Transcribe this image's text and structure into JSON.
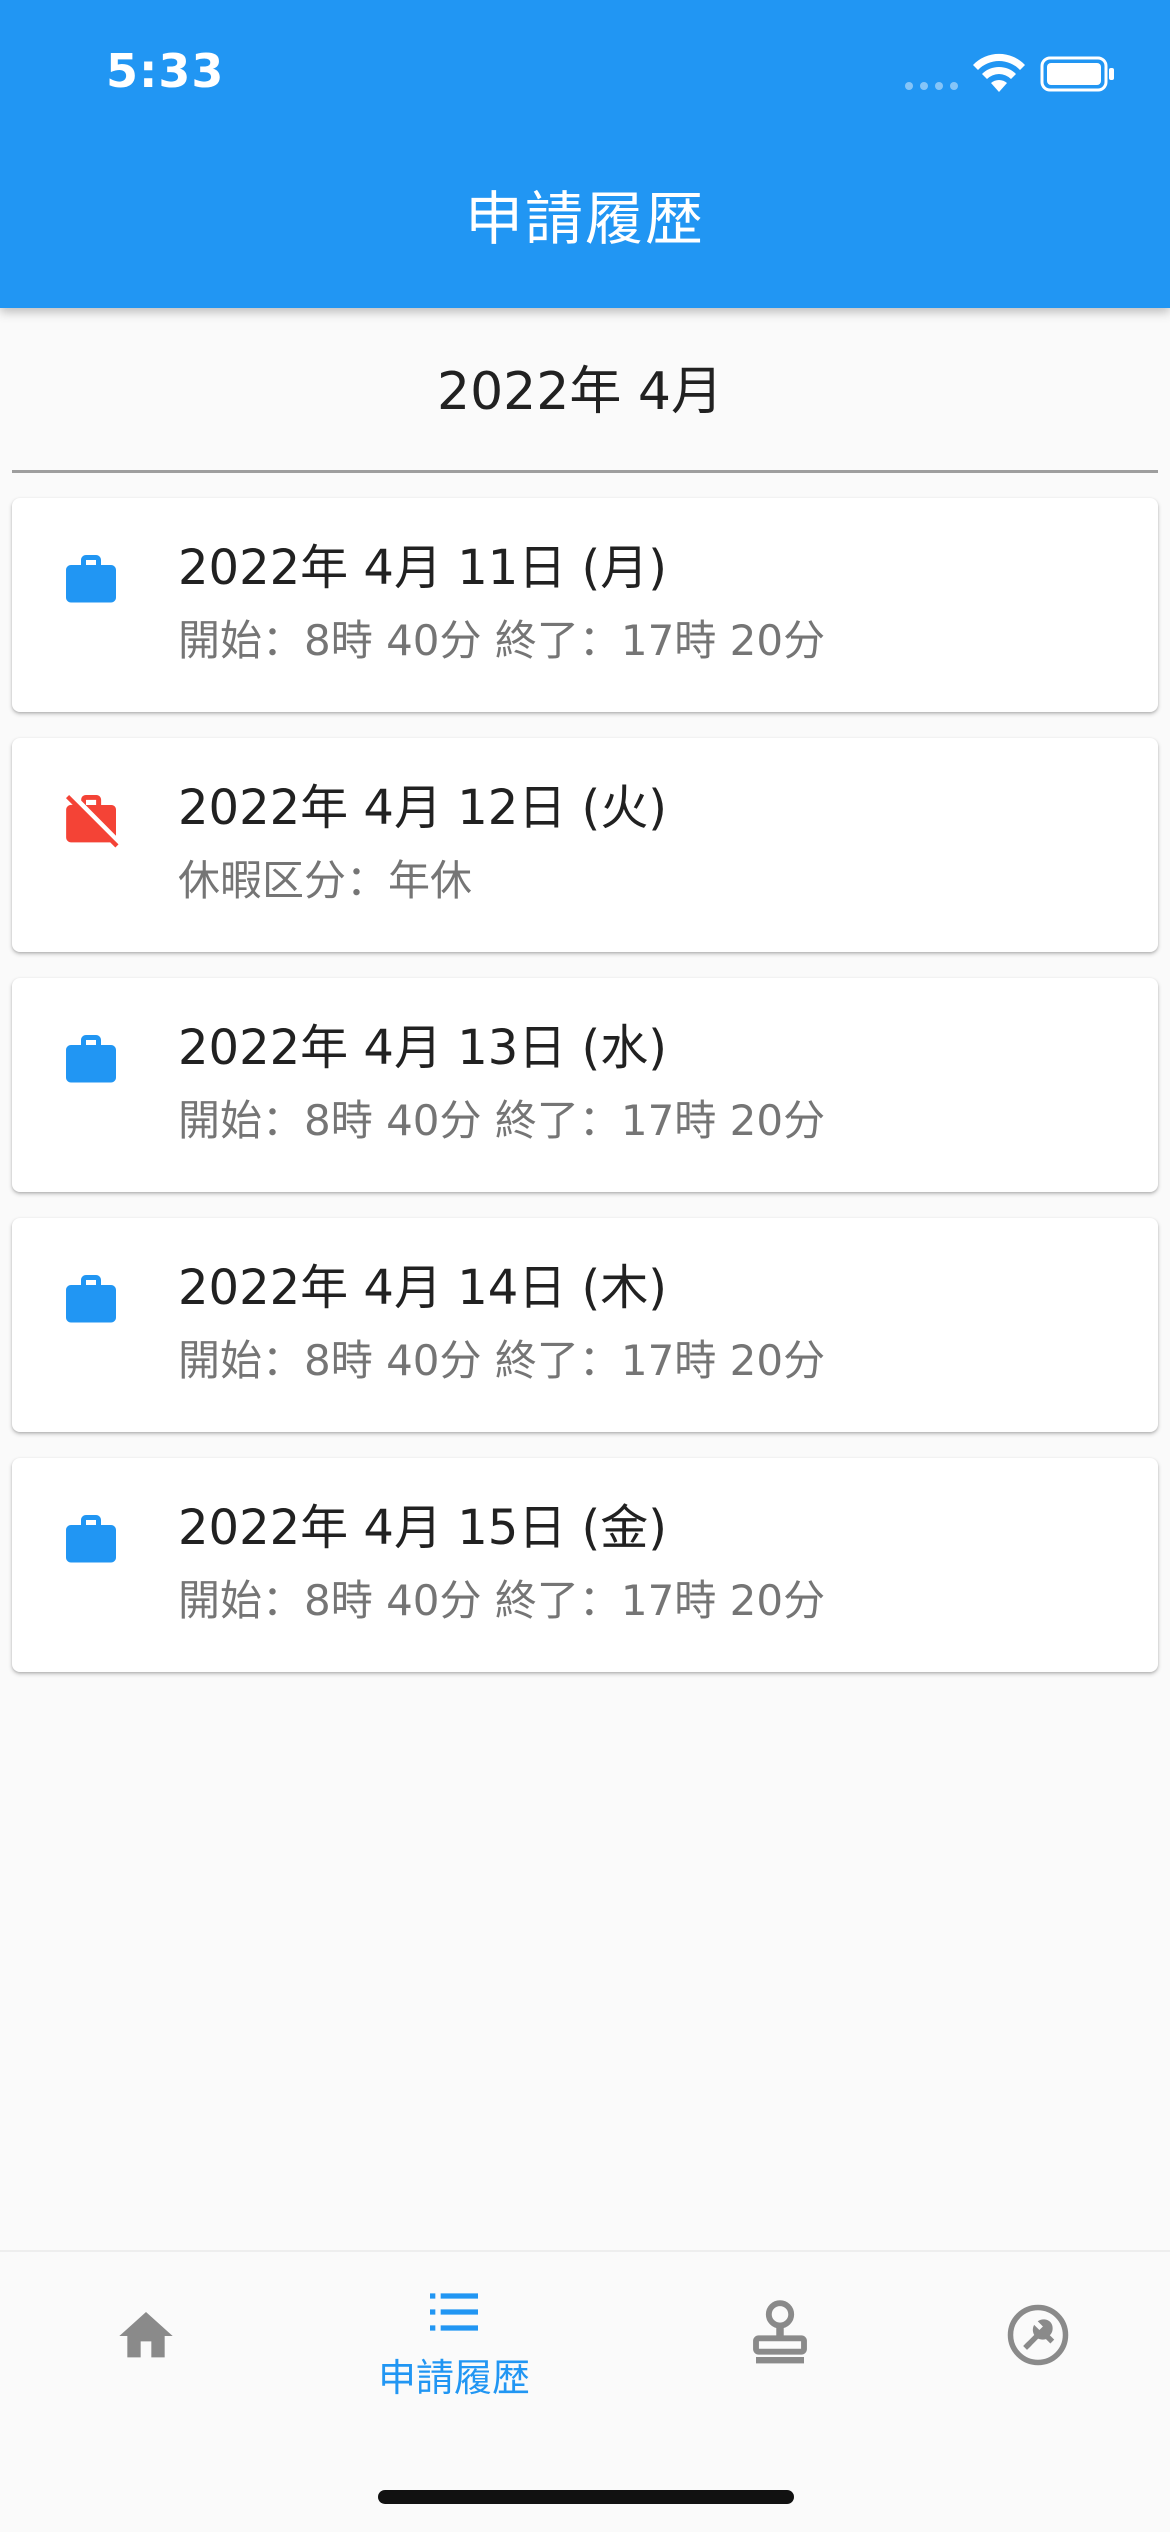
{
  "status_bar": {
    "time": "5:33"
  },
  "app_bar": {
    "title": "申請履歴"
  },
  "month_header": "2022年 4月",
  "colors": {
    "primary": "#2196f3",
    "work_icon": "#2196f3",
    "off_icon": "#f44336",
    "inactive_nav": "#8a8a8a"
  },
  "entries": [
    {
      "icon": "work-briefcase-icon",
      "date": "2022年 4月 11日 (月)",
      "detail": "開始：8時 40分   終了：17時 20分"
    },
    {
      "icon": "work-off-icon",
      "date": "2022年 4月 12日 (火)",
      "detail": "休暇区分：年休"
    },
    {
      "icon": "work-briefcase-icon",
      "date": "2022年 4月 13日 (水)",
      "detail": "開始：8時 40分   終了：17時 20分"
    },
    {
      "icon": "work-briefcase-icon",
      "date": "2022年 4月 14日 (木)",
      "detail": "開始：8時 40分   終了：17時 20分"
    },
    {
      "icon": "work-briefcase-icon",
      "date": "2022年 4月 15日 (金)",
      "detail": "開始：8時 40分   終了：17時 20分"
    }
  ],
  "bottom_nav": {
    "items": [
      {
        "icon": "home-icon",
        "label": "",
        "active": false
      },
      {
        "icon": "list-icon",
        "label": "申請履歴",
        "active": true
      },
      {
        "icon": "stamp-icon",
        "label": "",
        "active": false
      },
      {
        "icon": "settings-wrench-icon",
        "label": "",
        "active": false
      }
    ]
  }
}
